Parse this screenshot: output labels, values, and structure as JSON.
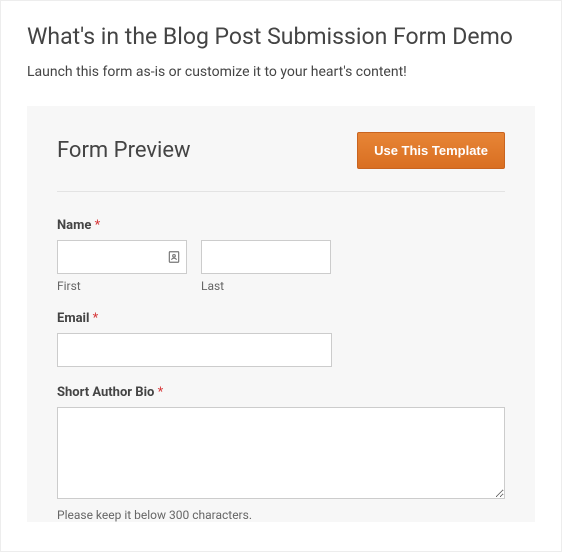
{
  "page": {
    "title": "What's in the Blog Post Submission Form Demo",
    "subtitle": "Launch this form as-is or customize it to your heart's content!"
  },
  "preview": {
    "heading": "Form Preview",
    "cta_label": "Use This Template"
  },
  "form": {
    "name": {
      "label": "Name",
      "required_marker": "*",
      "first_sublabel": "First",
      "last_sublabel": "Last",
      "first_value": "",
      "last_value": ""
    },
    "email": {
      "label": "Email",
      "required_marker": "*",
      "value": ""
    },
    "bio": {
      "label": "Short Author Bio",
      "required_marker": "*",
      "value": "",
      "helper": "Please keep it below 300 characters."
    }
  }
}
